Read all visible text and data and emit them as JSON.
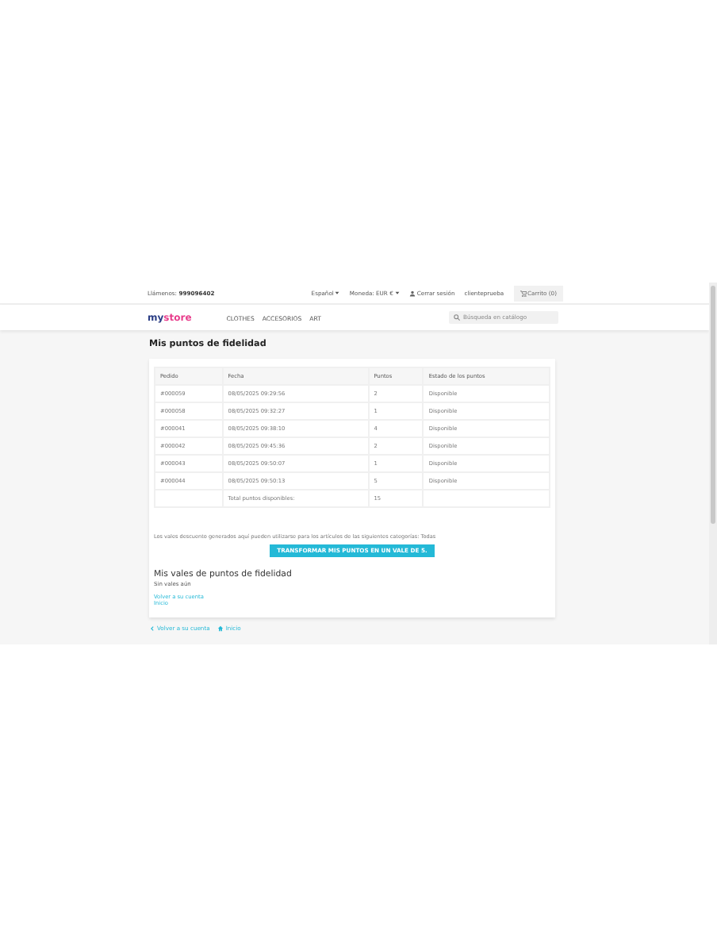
{
  "header": {
    "phone_label": "Llámenos:",
    "phone": "999096402",
    "language": "Español",
    "currency": "Moneda: EUR €",
    "logout": "Cerrar sesión",
    "user": "clienteprueba",
    "cart": "Carrito (0)"
  },
  "nav": {
    "logo_a": "my",
    "logo_b": "store",
    "items": [
      "CLOTHES",
      "ACCESORIOS",
      "ART"
    ],
    "search": {
      "placeholder": "Búsqueda en catálogo"
    }
  },
  "page_title": "Mis puntos de fidelidad",
  "table": {
    "columns": [
      "Pedido",
      "Fecha",
      "Puntos",
      "Estado de los puntos"
    ],
    "rows": [
      [
        "#000059",
        "08/05/2025 09:29:56",
        "2",
        "Disponible"
      ],
      [
        "#000058",
        "08/05/2025 09:32:27",
        "1",
        "Disponible"
      ],
      [
        "#000041",
        "08/05/2025 09:38:10",
        "4",
        "Disponible"
      ],
      [
        "#000042",
        "08/05/2025 09:45:36",
        "2",
        "Disponible"
      ],
      [
        "#000043",
        "08/05/2025 09:50:07",
        "1",
        "Disponible"
      ],
      [
        "#000044",
        "08/05/2025 09:50:13",
        "5",
        "Disponible"
      ]
    ],
    "total_label": "Total puntos disponibles:",
    "total": "15"
  },
  "note": "Los vales descuento generados aquí pueden utilizarse para los artículos de las siguientes categorías: Todas",
  "transform_button": "TRANSFORMAR MIS PUNTOS EN UN VALE DE 5.",
  "vouchers_title": "Mis vales de puntos de fidelidad",
  "vouchers_empty": "Sin vales aún",
  "card_links": [
    "Volver a su cuenta",
    "Inicio"
  ],
  "footer_links": [
    {
      "kind": "back",
      "label": "Volver a su cuenta"
    },
    {
      "kind": "home",
      "label": "Inicio"
    }
  ]
}
